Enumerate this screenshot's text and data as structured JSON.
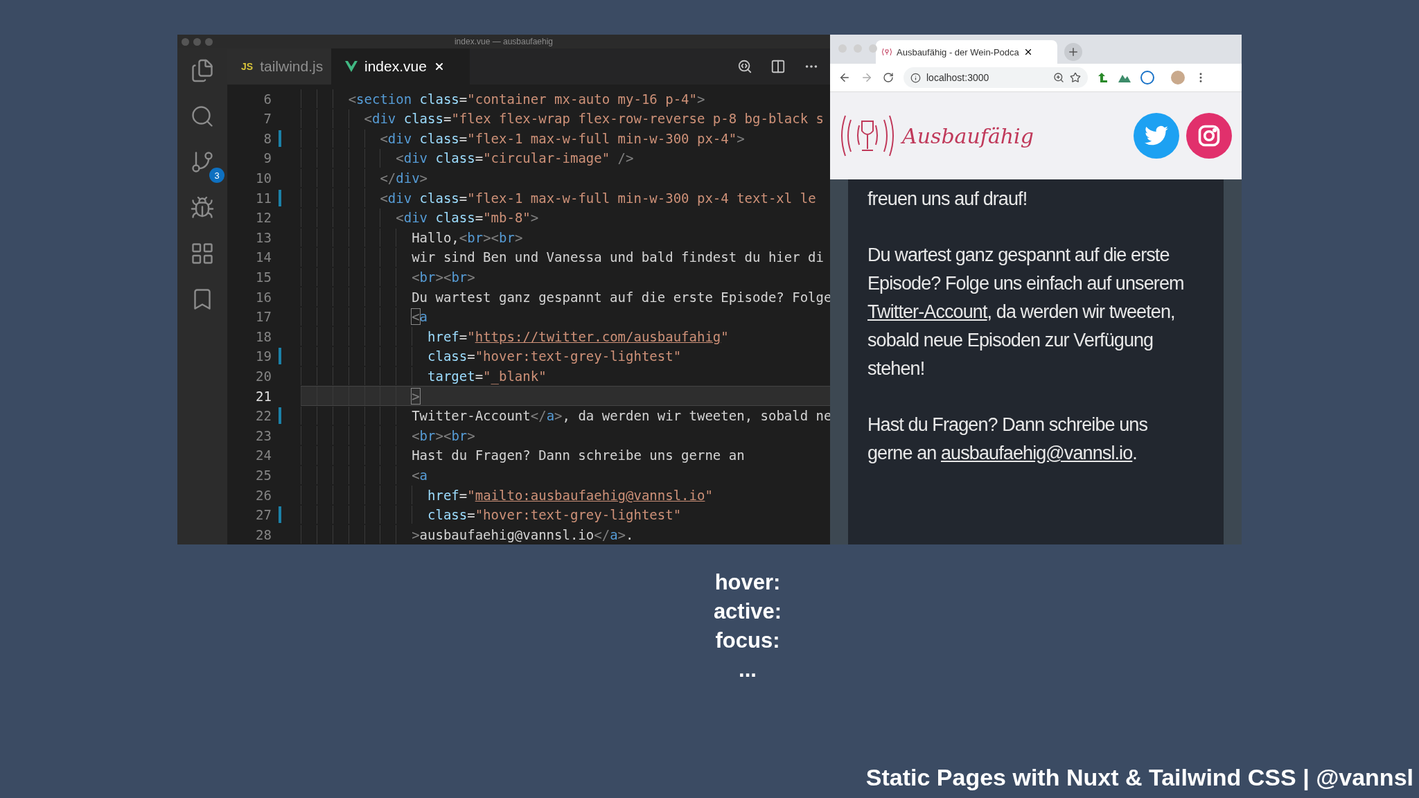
{
  "editor": {
    "title": "index.vue — ausbaufaehig",
    "activity_bar": [
      {
        "kind": "files",
        "selected": false
      },
      {
        "kind": "search",
        "selected": false
      },
      {
        "kind": "source-control",
        "selected": false,
        "badge": "3"
      },
      {
        "kind": "debug",
        "selected": false
      },
      {
        "kind": "extensions",
        "selected": false
      },
      {
        "kind": "bookmarks",
        "selected": false
      }
    ],
    "tabs": [
      {
        "icon_label": "JS",
        "kind": "js",
        "label": "tailwind.js",
        "selected": false
      },
      {
        "kind": "vue",
        "label": "index.vue",
        "selected": true
      }
    ],
    "lines": [
      {
        "number": "6",
        "modified": false,
        "current": false,
        "tokens": [
          {
            "kind": "punct",
            "t": "<"
          },
          {
            "kind": "tag",
            "t": "section"
          },
          {
            "kind": "attr",
            "t": " class"
          },
          {
            "kind": "text",
            "t": "="
          },
          {
            "kind": "string",
            "t": "\"container mx-auto my-16 p-4\""
          },
          {
            "kind": "punct",
            "t": ">"
          }
        ],
        "children": [
          {
            "number": "7",
            "modified": false,
            "current": false,
            "tokens": [
              {
                "kind": "punct",
                "t": "<"
              },
              {
                "kind": "tag",
                "t": "div"
              },
              {
                "kind": "attr",
                "t": " class"
              },
              {
                "kind": "text",
                "t": "="
              },
              {
                "kind": "string",
                "t": "\"flex flex-wrap flex-row-reverse p-8 bg-black s"
              }
            ],
            "children": [
              {
                "number": "8",
                "modified": true,
                "current": false,
                "tokens": [
                  {
                    "kind": "punct",
                    "t": "<"
                  },
                  {
                    "kind": "tag",
                    "t": "div"
                  },
                  {
                    "kind": "attr",
                    "t": " class"
                  },
                  {
                    "kind": "text",
                    "t": "="
                  },
                  {
                    "kind": "string",
                    "t": "\"flex-1 max-w-full min-w-300 px-4\""
                  },
                  {
                    "kind": "punct",
                    "t": ">"
                  }
                ],
                "children": [
                  {
                    "number": "9",
                    "modified": false,
                    "current": false,
                    "tokens": [
                      {
                        "kind": "punct",
                        "t": "<"
                      },
                      {
                        "kind": "tag",
                        "t": "div"
                      },
                      {
                        "kind": "attr",
                        "t": " class"
                      },
                      {
                        "kind": "text",
                        "t": "="
                      },
                      {
                        "kind": "string",
                        "t": "\"circular-image\""
                      },
                      {
                        "kind": "punct",
                        "t": " />"
                      }
                    ]
                  }
                ]
              },
              {
                "number": "10",
                "modified": false,
                "current": false,
                "tokens": [
                  {
                    "kind": "punct",
                    "t": "</"
                  },
                  {
                    "kind": "tag",
                    "t": "div"
                  },
                  {
                    "kind": "punct",
                    "t": ">"
                  }
                ]
              },
              {
                "number": "11",
                "modified": true,
                "current": false,
                "tokens": [
                  {
                    "kind": "punct",
                    "t": "<"
                  },
                  {
                    "kind": "tag",
                    "t": "div"
                  },
                  {
                    "kind": "attr",
                    "t": " class"
                  },
                  {
                    "kind": "text",
                    "t": "="
                  },
                  {
                    "kind": "string",
                    "t": "\"flex-1 max-w-full min-w-300 px-4 text-xl le"
                  }
                ],
                "children": [
                  {
                    "number": "12",
                    "modified": false,
                    "current": false,
                    "tokens": [
                      {
                        "kind": "punct",
                        "t": "<"
                      },
                      {
                        "kind": "tag",
                        "t": "div"
                      },
                      {
                        "kind": "attr",
                        "t": " class"
                      },
                      {
                        "kind": "text",
                        "t": "="
                      },
                      {
                        "kind": "string",
                        "t": "\"mb-8\""
                      },
                      {
                        "kind": "punct",
                        "t": ">"
                      }
                    ],
                    "children": [
                      {
                        "number": "13",
                        "modified": false,
                        "current": false,
                        "tokens": [
                          {
                            "kind": "text",
                            "t": "Hallo,"
                          },
                          {
                            "kind": "punct",
                            "t": "<"
                          },
                          {
                            "kind": "tag",
                            "t": "br"
                          },
                          {
                            "kind": "punct",
                            "t": "><"
                          },
                          {
                            "kind": "tag",
                            "t": "br"
                          },
                          {
                            "kind": "punct",
                            "t": ">"
                          }
                        ]
                      },
                      {
                        "number": "14",
                        "modified": false,
                        "current": false,
                        "tokens": [
                          {
                            "kind": "text",
                            "t": "wir sind Ben und Vanessa und bald findest du hier di"
                          }
                        ]
                      },
                      {
                        "number": "15",
                        "modified": false,
                        "current": false,
                        "tokens": [
                          {
                            "kind": "punct",
                            "t": "<"
                          },
                          {
                            "kind": "tag",
                            "t": "br"
                          },
                          {
                            "kind": "punct",
                            "t": "><"
                          },
                          {
                            "kind": "tag",
                            "t": "br"
                          },
                          {
                            "kind": "punct",
                            "t": ">"
                          }
                        ]
                      },
                      {
                        "number": "16",
                        "modified": false,
                        "current": false,
                        "tokens": [
                          {
                            "kind": "text",
                            "t": "Du wartest ganz gespannt auf die erste Episode? Folge"
                          }
                        ]
                      },
                      {
                        "number": "17",
                        "modified": false,
                        "current": false,
                        "tokens": [
                          {
                            "kind": "match",
                            "t": "<"
                          },
                          {
                            "kind": "tag",
                            "t": "a"
                          }
                        ],
                        "children": [
                          {
                            "number": "18",
                            "modified": false,
                            "current": false,
                            "tokens": [
                              {
                                "kind": "attr",
                                "t": "href"
                              },
                              {
                                "kind": "text",
                                "t": "="
                              },
                              {
                                "kind": "string",
                                "t": "\""
                              },
                              {
                                "kind": "link",
                                "t": "https://twitter.com/ausbaufahig"
                              },
                              {
                                "kind": "string",
                                "t": "\""
                              }
                            ]
                          },
                          {
                            "number": "19",
                            "modified": true,
                            "current": false,
                            "tokens": [
                              {
                                "kind": "attr",
                                "t": "class"
                              },
                              {
                                "kind": "text",
                                "t": "="
                              },
                              {
                                "kind": "string",
                                "t": "\"hover:text-grey-lightest\""
                              }
                            ]
                          },
                          {
                            "number": "20",
                            "modified": false,
                            "current": false,
                            "tokens": [
                              {
                                "kind": "attr",
                                "t": "target"
                              },
                              {
                                "kind": "text",
                                "t": "="
                              },
                              {
                                "kind": "string",
                                "t": "\"_blank\""
                              }
                            ]
                          }
                        ]
                      },
                      {
                        "number": "21",
                        "modified": false,
                        "current": true,
                        "tokens": [
                          {
                            "kind": "match",
                            "t": ">"
                          }
                        ]
                      },
                      {
                        "number": "22",
                        "modified": true,
                        "current": false,
                        "tokens": [
                          {
                            "kind": "text",
                            "t": "Twitter-Account"
                          },
                          {
                            "kind": "punct",
                            "t": "</"
                          },
                          {
                            "kind": "tag",
                            "t": "a"
                          },
                          {
                            "kind": "punct",
                            "t": ">"
                          },
                          {
                            "kind": "text",
                            "t": ", da werden wir tweeten, sobald ne"
                          }
                        ]
                      },
                      {
                        "number": "23",
                        "modified": false,
                        "current": false,
                        "tokens": [
                          {
                            "kind": "punct",
                            "t": "<"
                          },
                          {
                            "kind": "tag",
                            "t": "br"
                          },
                          {
                            "kind": "punct",
                            "t": "><"
                          },
                          {
                            "kind": "tag",
                            "t": "br"
                          },
                          {
                            "kind": "punct",
                            "t": ">"
                          }
                        ]
                      },
                      {
                        "number": "24",
                        "modified": false,
                        "current": false,
                        "tokens": [
                          {
                            "kind": "text",
                            "t": "Hast du Fragen? Dann schreibe uns gerne an"
                          }
                        ]
                      },
                      {
                        "number": "25",
                        "modified": false,
                        "current": false,
                        "tokens": [
                          {
                            "kind": "punct",
                            "t": "<"
                          },
                          {
                            "kind": "tag",
                            "t": "a"
                          }
                        ],
                        "children": [
                          {
                            "number": "26",
                            "modified": false,
                            "current": false,
                            "tokens": [
                              {
                                "kind": "attr",
                                "t": "href"
                              },
                              {
                                "kind": "text",
                                "t": "="
                              },
                              {
                                "kind": "string",
                                "t": "\""
                              },
                              {
                                "kind": "link",
                                "t": "mailto:ausbaufaehig@vannsl.io"
                              },
                              {
                                "kind": "string",
                                "t": "\""
                              }
                            ]
                          },
                          {
                            "number": "27",
                            "modified": true,
                            "current": false,
                            "tokens": [
                              {
                                "kind": "attr",
                                "t": "class"
                              },
                              {
                                "kind": "text",
                                "t": "="
                              },
                              {
                                "kind": "string",
                                "t": "\"hover:text-grey-lightest\""
                              }
                            ]
                          }
                        ]
                      },
                      {
                        "number": "28",
                        "modified": false,
                        "current": false,
                        "tokens": [
                          {
                            "kind": "punct",
                            "t": ">"
                          },
                          {
                            "kind": "text",
                            "t": "ausbaufaehig@vannsl.io"
                          },
                          {
                            "kind": "punct",
                            "t": "</"
                          },
                          {
                            "kind": "tag",
                            "t": "a"
                          },
                          {
                            "kind": "punct",
                            "t": ">"
                          },
                          {
                            "kind": "text",
                            "t": "."
                          }
                        ]
                      }
                    ]
                  }
                ]
              }
            ]
          }
        ]
      }
    ]
  },
  "browser": {
    "tab_title": "Ausbaufähig - der Wein-Podca",
    "address": "localhost:3000",
    "site": {
      "brand": "Ausbaufähig",
      "paragraphs": [
        [
          {
            "kind": "text",
            "text": "freuen uns auf drauf!"
          }
        ],
        [
          {
            "kind": "text",
            "text": "Du wartest ganz gespannt auf die erste Episode? Folge uns einfach auf unserem "
          },
          {
            "kind": "link",
            "text": "Twitter-Account"
          },
          {
            "kind": "text",
            "text": ", da werden wir tweeten, sobald neue Episoden zur Verfügung stehen!"
          }
        ],
        [
          {
            "kind": "text",
            "text": "Hast du Fragen? Dann schreibe uns gerne an "
          },
          {
            "kind": "link",
            "text": "ausbaufaehig@vannsl.io"
          },
          {
            "kind": "text",
            "text": "."
          }
        ]
      ]
    }
  },
  "slide": {
    "bullets": [
      "hover:",
      "active:",
      "focus:",
      "..."
    ],
    "footer": "Static Pages with Nuxt & Tailwind CSS | @vannsl"
  }
}
